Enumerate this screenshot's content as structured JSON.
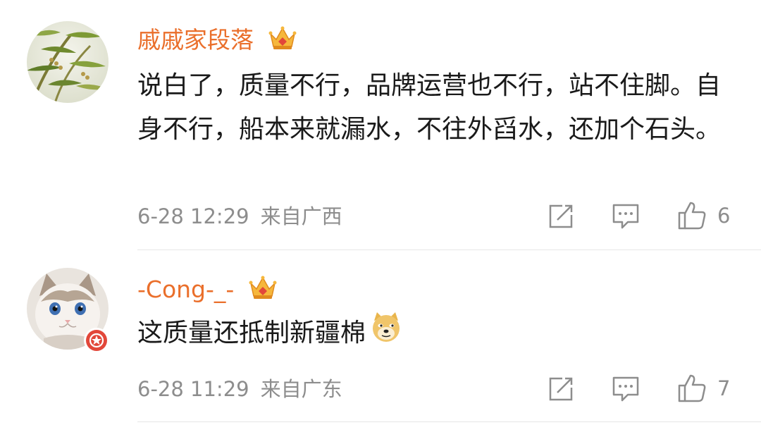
{
  "comments": [
    {
      "username": "戚戚家段落",
      "text": "说白了，质量不行，品牌运营也不行，站不住脚。自身不行，船本来就漏水，不往外舀水，还加个石头。",
      "date": "6-28 12:29",
      "location": "来自广西",
      "likes": "6",
      "avatar_icon": "bamboo-avatar",
      "badge_icon": "crown-icon"
    },
    {
      "username": "-Cong-_-",
      "text": "这质量还抵制新疆棉",
      "date": "6-28 11:29",
      "location": "来自广东",
      "likes": "7",
      "avatar_icon": "cat-avatar",
      "badge_icon": "crown-icon",
      "emoji": "doge-emoji"
    }
  ],
  "colors": {
    "username": "#ea6f2b",
    "meta": "#8d8d8d",
    "text": "#1a1a1a"
  }
}
